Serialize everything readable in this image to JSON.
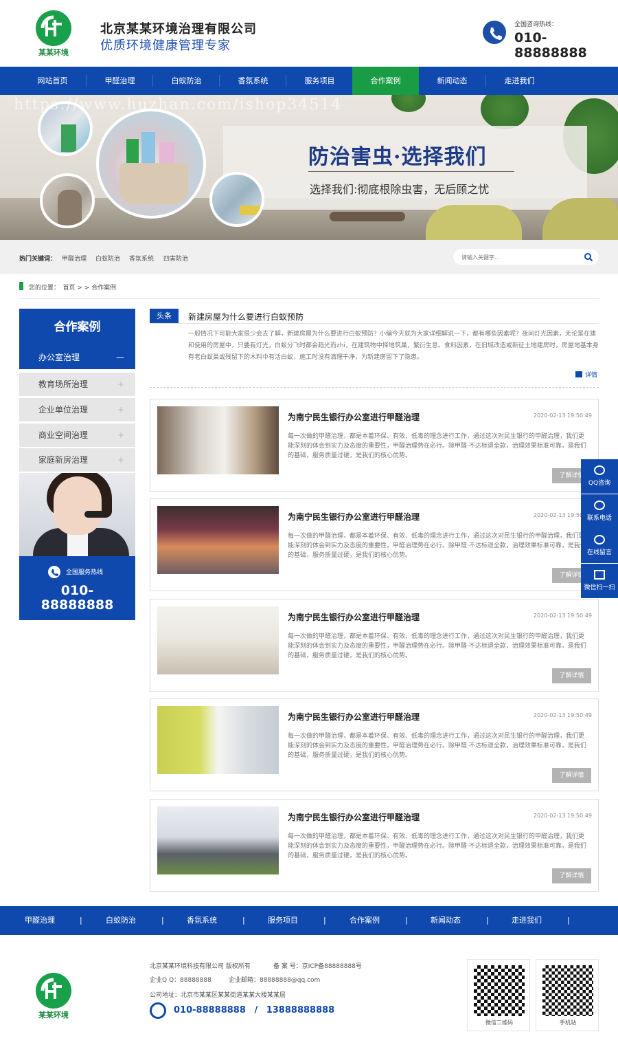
{
  "header": {
    "logo_text": "某某环境",
    "company_name": "北京某某环境治理有限公司",
    "slogan": "优质环境健康管理专家",
    "hotline_label": "全国咨询热线：",
    "hotline_number": "010-88888888"
  },
  "nav": {
    "items": [
      "网站首页",
      "甲醛治理",
      "白蚁防治",
      "香氛系统",
      "服务项目",
      "合作案例",
      "新闻动态",
      "走进我们"
    ],
    "active": "合作案例"
  },
  "banner": {
    "title": "防治害虫·选择我们",
    "subtitle": "选择我们:彻底根除虫害，无后顾之忧",
    "watermark": "https://www.huzhan.com/ishop34514"
  },
  "search": {
    "hot_label": "热门关键词：",
    "keywords": [
      "甲醛治理",
      "白蚁防治",
      "香氛系统",
      "四害防治"
    ],
    "placeholder": "请输入关键字..."
  },
  "breadcrumb": {
    "text": "您的位置：　首页 > > 合作案例"
  },
  "sidebar": {
    "title": "合作案例",
    "items": [
      {
        "label": "办公室治理",
        "mark": "—"
      },
      {
        "label": "教育场所治理",
        "mark": "+"
      },
      {
        "label": "企业单位治理",
        "mark": "+"
      },
      {
        "label": "商业空间治理",
        "mark": "+"
      },
      {
        "label": "家庭新房治理",
        "mark": "+"
      }
    ],
    "hotline_label": "全国服务热线",
    "hotline_number_1": "010-",
    "hotline_number_2": "88888888"
  },
  "headline": {
    "tag": "头条",
    "title": "新建房屋为什么要进行白蚁预防",
    "body": "一般情况下可能大家很少会去了解，新建房屋为什么要进行白蚁预防？小编今天就为大家详细解说一下，都有哪些因素呢？夜间灯光因素，无论是在建和使用的房屋中，只要有灯光，白蚁分飞时都会趋光而zhi，在建筑物中择地筑巢，繁衍生息。食料因素，在旧城改造或新征土地建房时，房屋地基本身有老白蚁巢或残留下的木料中有活白蚁，施工时没有清理干净，为新建房留下了隐患。",
    "more": "详情"
  },
  "cases": [
    {
      "title": "为南宁民生银行办公室进行甲醛治理",
      "date": "2020-02-13 19:50:49",
      "desc": "每一次做的甲醛治理，都是本着环保、有效、低毒的理念进行工作，通过这次对民生银行的甲醛治理，我们更能深刻的体会到实力及态度的重要性，甲醛治理势在必行。除甲醛·不达标退全款，治理效果标准可靠，是我们的基础，服务质量过硬，是我们的核心优势。",
      "button": "了解详情"
    },
    {
      "title": "为南宁民生银行办公室进行甲醛治理",
      "date": "2020-02-13 19:50:49",
      "desc": "每一次做的甲醛治理，都是本着环保、有效、低毒的理念进行工作，通过这次对民生银行的甲醛治理，我们更能深刻的体会到实力及态度的重要性，甲醛治理势在必行。除甲醛·不达标退全款，治理效果标准可靠，是我们的基础，服务质量过硬，是我们的核心优势。",
      "button": "了解详情"
    },
    {
      "title": "为南宁民生银行办公室进行甲醛治理",
      "date": "2020-02-13 19:50:49",
      "desc": "每一次做的甲醛治理，都是本着环保、有效、低毒的理念进行工作，通过这次对民生银行的甲醛治理，我们更能深刻的体会到实力及态度的重要性，甲醛治理势在必行。除甲醛·不达标退全款，治理效果标准可靠，是我们的基础，服务质量过硬，是我们的核心优势。",
      "button": "了解详情"
    },
    {
      "title": "为南宁民生银行办公室进行甲醛治理",
      "date": "2020-02-13 19:50:49",
      "desc": "每一次做的甲醛治理，都是本着环保、有效、低毒的理念进行工作，通过这次对民生银行的甲醛治理，我们更能深刻的体会到实力及态度的重要性，甲醛治理势在必行。除甲醛·不达标退全款，治理效果标准可靠，是我们的基础，服务质量过硬，是我们的核心优势。",
      "button": "了解详情"
    },
    {
      "title": "为南宁民生银行办公室进行甲醛治理",
      "date": "2020-02-13 19:50:49",
      "desc": "每一次做的甲醛治理，都是本着环保、有效、低毒的理念进行工作，通过这次对民生银行的甲醛治理，我们更能深刻的体会到实力及态度的重要性，甲醛治理势在必行。除甲醛·不达标退全款，治理效果标准可靠，是我们的基础，服务质量过硬，是我们的核心优势。",
      "button": "了解详情"
    }
  ],
  "float_tools": [
    {
      "label": "QQ咨询",
      "icon": "qq-icon"
    },
    {
      "label": "联系电话",
      "icon": "phone-icon"
    },
    {
      "label": "在线留言",
      "icon": "message-icon"
    },
    {
      "label": "微信扫一扫",
      "icon": "qrcode-icon"
    }
  ],
  "footer_nav": {
    "items": [
      "甲醛治理",
      "白蚁防治",
      "香氛系统",
      "服务项目",
      "合作案例",
      "新闻动态",
      "走进我们"
    ],
    "separator": "|"
  },
  "footer": {
    "logo_text": "某某环境",
    "copyright": "北京某某环境科技有限公司 版权所有",
    "icp": "备 案 号：京ICP备88888888号",
    "qq": "企业Q Q：88888888",
    "email": "企业邮箱：88888888@qq.com",
    "address": "公司地址：北京市某某区某某街道某某大楼某某层",
    "phone_1": "010-88888888",
    "phone_sep": "/",
    "phone_2": "13888888888",
    "qr_wechat_label": "微信二维码",
    "qr_mobile_label": "手机站"
  }
}
